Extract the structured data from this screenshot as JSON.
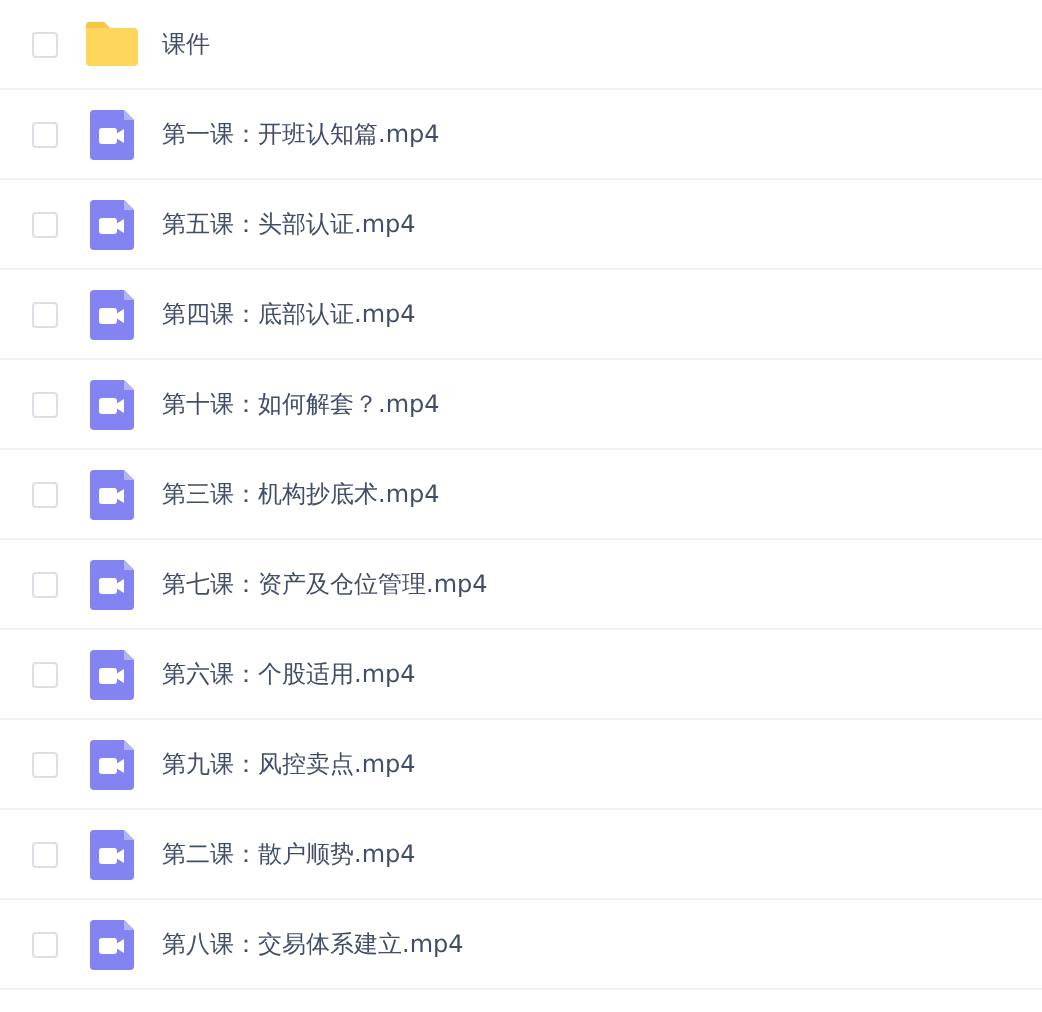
{
  "files": [
    {
      "kind": "folder",
      "name": "课件",
      "checked": false
    },
    {
      "kind": "video",
      "name": "第一课：开班认知篇.mp4",
      "checked": false
    },
    {
      "kind": "video",
      "name": "第五课：头部认证.mp4",
      "checked": false
    },
    {
      "kind": "video",
      "name": "第四课：底部认证.mp4",
      "checked": false
    },
    {
      "kind": "video",
      "name": "第十课：如何解套？.mp4",
      "checked": false
    },
    {
      "kind": "video",
      "name": "第三课：机构抄底术.mp4",
      "checked": false
    },
    {
      "kind": "video",
      "name": "第七课：资产及仓位管理.mp4",
      "checked": false
    },
    {
      "kind": "video",
      "name": "第六课：个股适用.mp4",
      "checked": false
    },
    {
      "kind": "video",
      "name": "第九课：风控卖点.mp4",
      "checked": false
    },
    {
      "kind": "video",
      "name": "第二课：散户顺势.mp4",
      "checked": false
    },
    {
      "kind": "video",
      "name": "第八课：交易体系建立.mp4",
      "checked": false
    }
  ]
}
